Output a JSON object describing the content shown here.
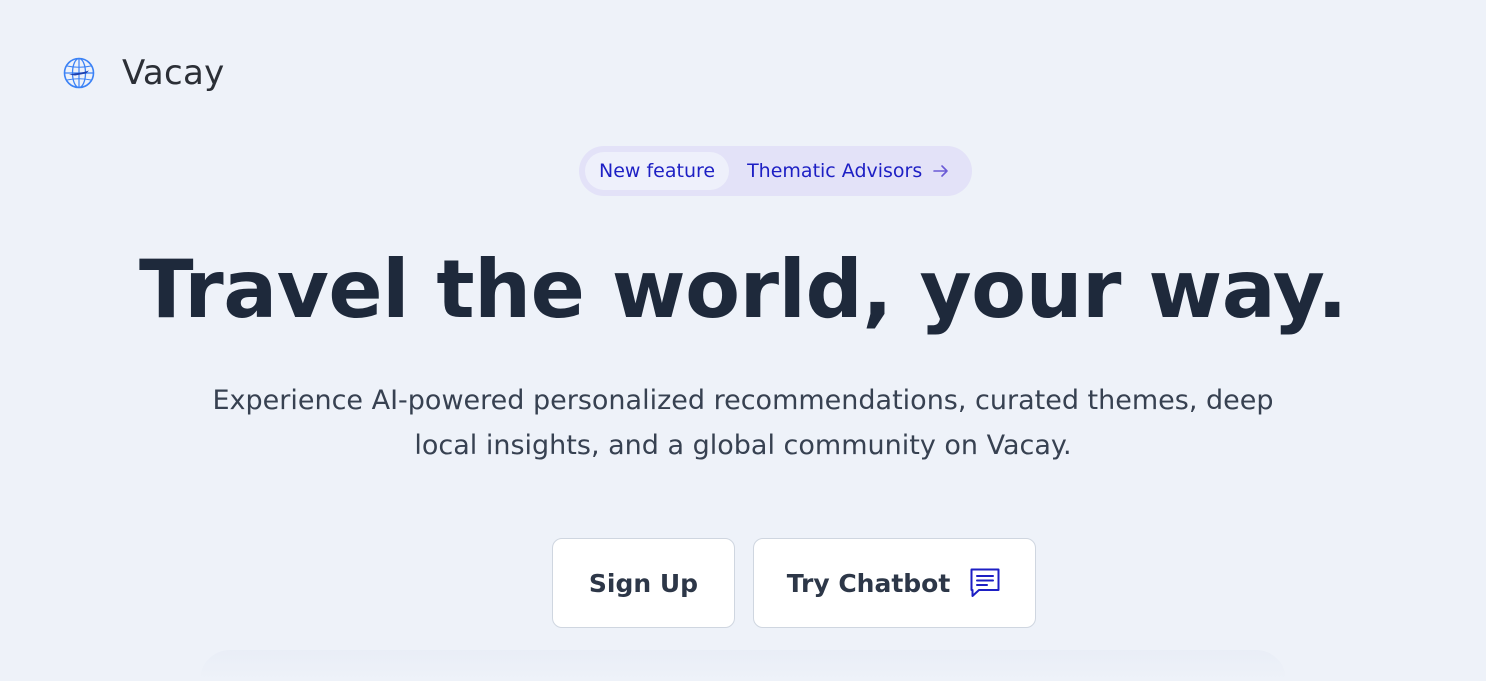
{
  "header": {
    "brand": "Vacay",
    "logo_icon": "globe-icon"
  },
  "announcement": {
    "badge": "New feature",
    "link_label": "Thematic Advisors",
    "arrow_icon": "arrow-right-icon"
  },
  "hero": {
    "title": "Travel the world, your way.",
    "subtitle": "Experience AI-powered personalized recommendations, curated themes, deep local insights, and a global community on Vacay."
  },
  "actions": {
    "signup_label": "Sign Up",
    "chatbot_label": "Try Chatbot",
    "chatbot_icon": "chat-icon"
  },
  "colors": {
    "background": "#eef2f9",
    "accent": "#1d1fc4",
    "title": "#1e293b",
    "logo": "#3b82f6"
  }
}
